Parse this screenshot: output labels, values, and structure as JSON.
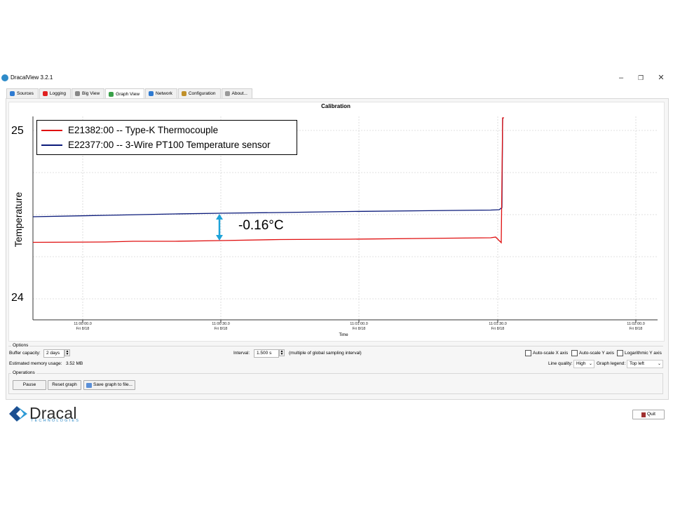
{
  "window": {
    "title": "DracalView 3.2.1"
  },
  "tabs": [
    {
      "label": "Sources",
      "icon": "sources-icon",
      "color": "#2e7ad1",
      "active": false
    },
    {
      "label": "Logging",
      "icon": "record-icon",
      "color": "#e02020",
      "active": false
    },
    {
      "label": "Big View",
      "icon": "bigview-icon",
      "color": "#888888",
      "active": false
    },
    {
      "label": "Graph View",
      "icon": "graph-icon",
      "color": "#3aa14a",
      "active": true
    },
    {
      "label": "Network",
      "icon": "network-icon",
      "color": "#2e7ad1",
      "active": false
    },
    {
      "label": "Configuration",
      "icon": "wrench-icon",
      "color": "#c0902a",
      "active": false
    },
    {
      "label": "About...",
      "icon": "info-icon",
      "color": "#999999",
      "active": false
    }
  ],
  "graph": {
    "title": "Calibration",
    "y_axis_label": "Temperature",
    "x_axis_title": "Time",
    "y_ticks": [
      "25",
      "24"
    ],
    "x_ticks": [
      {
        "time": "11:00:00.0",
        "day": "Fri 8/18"
      },
      {
        "time": "11:00:30.0",
        "day": "Fri 8/18"
      },
      {
        "time": "11:01:00.0",
        "day": "Fri 8/18"
      },
      {
        "time": "11:01:30.0",
        "day": "Fri 8/18"
      },
      {
        "time": "11:02:00.0",
        "day": "Fri 8/18"
      }
    ],
    "legend": [
      {
        "label": "E21382:00 -- Type-K Thermocouple",
        "color": "#e01010"
      },
      {
        "label": "E22377:00 -- 3-Wire PT100 Temperature sensor",
        "color": "#0a1a7a"
      }
    ],
    "annotation": {
      "text": "-0.16°C",
      "color": "#1ea3d9"
    }
  },
  "options": {
    "group_title": "Options",
    "buffer_capacity_label": "Buffer capacity:",
    "buffer_capacity_value": "2 days",
    "interval_label": "Interval:",
    "interval_value": "1.500 s",
    "interval_note": "(multiple of global sampling interval)",
    "autoscale_x_label": "Auto-scale X axis",
    "autoscale_y_label": "Auto-scale Y axis",
    "log_y_label": "Logarithmic Y axis",
    "memory_label": "Estimated memory usage:",
    "memory_value": "3.52 MB",
    "line_quality_label": "Line quality:",
    "line_quality_value": "High",
    "graph_legend_label": "Graph legend:",
    "graph_legend_value": "Top left"
  },
  "operations": {
    "group_title": "Operations",
    "pause_label": "Pause",
    "reset_label": "Reset graph",
    "save_label": "Save graph to file..."
  },
  "footer": {
    "logo_text": "Dracal",
    "logo_sub": "TECHNOLOGIES",
    "quit_label": "Quit"
  }
}
